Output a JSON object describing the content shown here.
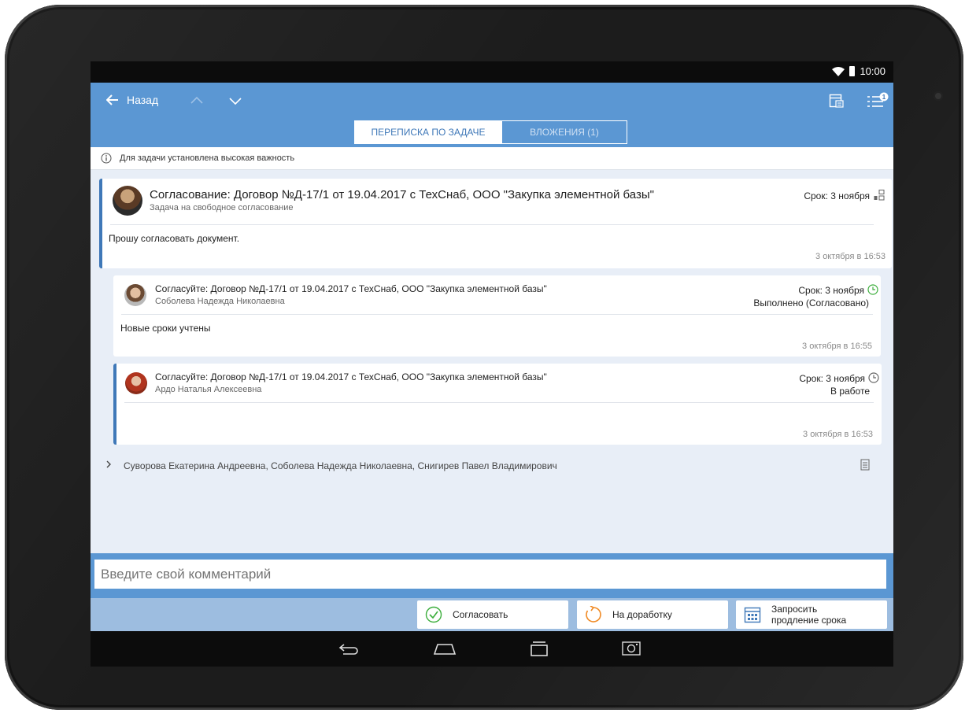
{
  "status_bar": {
    "time": "10:00"
  },
  "toolbar": {
    "back_label": "Назад"
  },
  "tabs": [
    {
      "label": "ПЕРЕПИСКА ПО ЗАДАЧЕ"
    },
    {
      "label": "ВЛОЖЕНИЯ (1)"
    }
  ],
  "notice": "Для задачи установлена высокая важность",
  "badge_count": "1",
  "messages": [
    {
      "title": "Согласование: Договор №Д-17/1 от 19.04.2017 с ТехСнаб, ООО \"Закупка элементной базы\"",
      "subtitle": "Задача на свободное согласование",
      "due": "Срок: 3 ноября",
      "status": "",
      "body": "Прошу согласовать документ.",
      "time": "3 октября в 16:53"
    },
    {
      "title": "Согласуйте: Договор №Д-17/1 от 19.04.2017 с ТехСнаб, ООО \"Закупка элементной базы\"",
      "subtitle": "Соболева Надежда Николаевна",
      "due": "Срок: 3 ноября",
      "status": "Выполнено (Согласовано)",
      "body": "Новые сроки учтены",
      "time": "3 октября в 16:55"
    },
    {
      "title": "Согласуйте: Договор №Д-17/1 от 19.04.2017 с ТехСнаб, ООО \"Закупка элементной базы\"",
      "subtitle": "Ардо Наталья Алексеевна",
      "due": "Срок: 3 ноября",
      "status": "В работе",
      "body": "",
      "time": "3 октября в 16:53"
    }
  ],
  "participants": "Суворова Екатерина Андреевна, Соболева Надежда Николаевна, Снигирев Павел Владимирович",
  "comment": {
    "placeholder": "Введите свой комментарий"
  },
  "actions": {
    "approve": "Согласовать",
    "rework": "На доработку",
    "extend_line1": "Запросить",
    "extend_line2": "продление срока"
  },
  "colors": {
    "toolbar": "#5b97d3",
    "accent": "#3f78b8",
    "background": "#e8eef7",
    "success": "#3cae3c",
    "warning": "#f08a24"
  },
  "icons": [
    "back-arrow-icon",
    "chevron-up-icon",
    "chevron-down-icon",
    "calendar-icon",
    "task-list-icon",
    "info-icon",
    "approval-scheme-icon",
    "clock-icon",
    "chevron-right-icon",
    "document-icon",
    "check-circle-icon",
    "undo-icon",
    "calendar-grid-icon",
    "wifi-icon",
    "battery-icon",
    "nav-back-icon",
    "nav-home-icon",
    "nav-recents-icon",
    "screenshot-icon"
  ]
}
